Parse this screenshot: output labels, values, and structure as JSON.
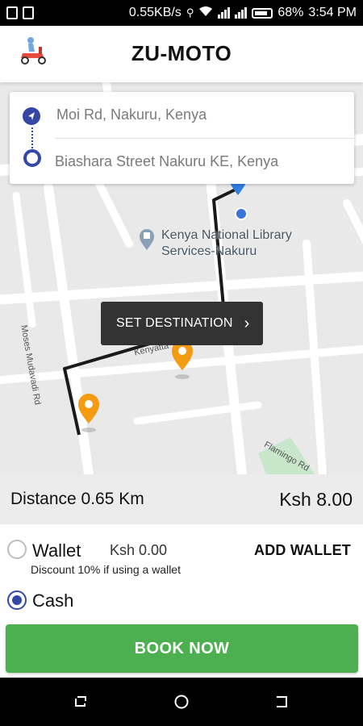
{
  "status_bar": {
    "speed": "0.55KB/s",
    "battery": "68%",
    "time": "3:54 PM"
  },
  "header": {
    "title": "ZU-MOTO",
    "logo_icon": "scooter-rider-icon"
  },
  "route": {
    "pickup": "Moi Rd, Nakuru, Kenya",
    "destination": "Biashara Street Nakuru KE, Kenya"
  },
  "map": {
    "poi_name_line1": "Kenya National Library",
    "poi_name_line2": "Services-Nakuru",
    "street_1": "Moses Mudavadi Rd",
    "street_2": "Kenyatta",
    "street_3": "Flamingo Rd",
    "set_destination_label": "SET DESTINATION",
    "colors": {
      "route": "#1a1a1a",
      "pin_orange": "#f39c12",
      "pin_blue": "#2f7ee0"
    }
  },
  "fare": {
    "distance_label": "Distance 0.65 Km",
    "price": "Ksh 8.00"
  },
  "payment": {
    "wallet_label": "Wallet",
    "wallet_balance": "Ksh 0.00",
    "add_wallet_label": "ADD WALLET",
    "discount_note": "Discount 10% if using a wallet",
    "cash_label": "Cash",
    "selected": "Cash"
  },
  "book_button_label": "BOOK NOW",
  "accent_color": "#4caf50"
}
